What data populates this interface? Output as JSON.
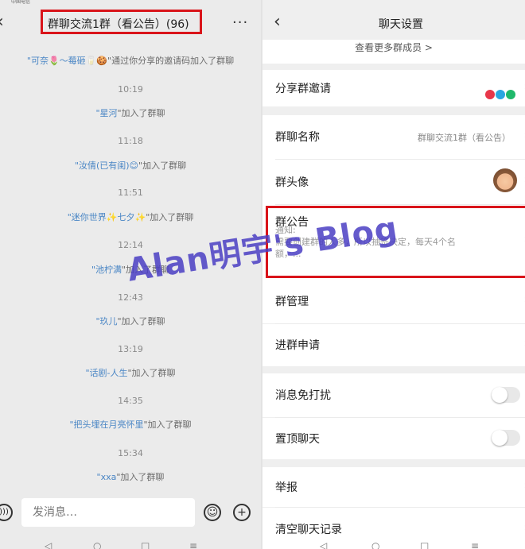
{
  "status": {
    "carrier": "中国电信"
  },
  "chat": {
    "title": "群聊交流1群（看公告）(96)",
    "back_icon": "chevron-left-icon",
    "more_icon": "ellipsis-icon",
    "messages": [
      {
        "type": "system",
        "nick": "\"可奈🌷～莓砸🥛🍪",
        "text": "\"通过你分享的邀请码加入了群聊"
      },
      {
        "type": "time",
        "text": "10:19"
      },
      {
        "type": "system",
        "nick": "\"星河",
        "text": "\"加入了群聊"
      },
      {
        "type": "time",
        "text": "11:18"
      },
      {
        "type": "system",
        "nick": "\"汝倩(已有闺)😊",
        "text": "\"加入了群聊"
      },
      {
        "type": "time",
        "text": "11:51"
      },
      {
        "type": "system",
        "nick": "\"迷你世界✨七夕✨",
        "text": "\"加入了群聊"
      },
      {
        "type": "time",
        "text": "12:14"
      },
      {
        "type": "system",
        "nick": "\"池柠满",
        "text": "\"加入了群聊"
      },
      {
        "type": "time",
        "text": "12:43"
      },
      {
        "type": "system",
        "nick": "\"玖儿",
        "text": "\"加入了群聊"
      },
      {
        "type": "time",
        "text": "13:19"
      },
      {
        "type": "system",
        "nick": "\"话剧-人生",
        "text": "\"加入了群聊"
      },
      {
        "type": "time",
        "text": "14:35"
      },
      {
        "type": "system",
        "nick": "\"把头埋在月亮怀里",
        "text": "\"加入了群聊"
      },
      {
        "type": "time",
        "text": "15:34"
      },
      {
        "type": "system",
        "nick": "\"xxa",
        "text": "\"加入了群聊"
      }
    ],
    "input_placeholder": "发消息…"
  },
  "settings": {
    "title": "聊天设置",
    "more_members": "查看更多群成员 >",
    "rows": {
      "share": "分享群邀请",
      "name_label": "群聊名称",
      "name_value": "群聊交流1群（看公告）",
      "avatar": "群头像",
      "notice_label": "群公告",
      "notice_preview": "通知:\n需要创建群的人多，所以抽签决定，每天4个名\n额，...",
      "manage": "群管理",
      "join_requests": "进群申请",
      "mute": "消息免打扰",
      "pin": "置顶聊天",
      "report": "举报",
      "clear": "清空聊天记录"
    },
    "toggles": {
      "mute": false,
      "pin": false
    },
    "share_colors": [
      "#e8374a",
      "#2aa6e0",
      "#1fb86a"
    ]
  },
  "watermark": "Alan明宇's Blog",
  "colors": {
    "highlight": "#d9141a",
    "nick": "#4a86c5",
    "watermark": "#4b3fc4"
  }
}
